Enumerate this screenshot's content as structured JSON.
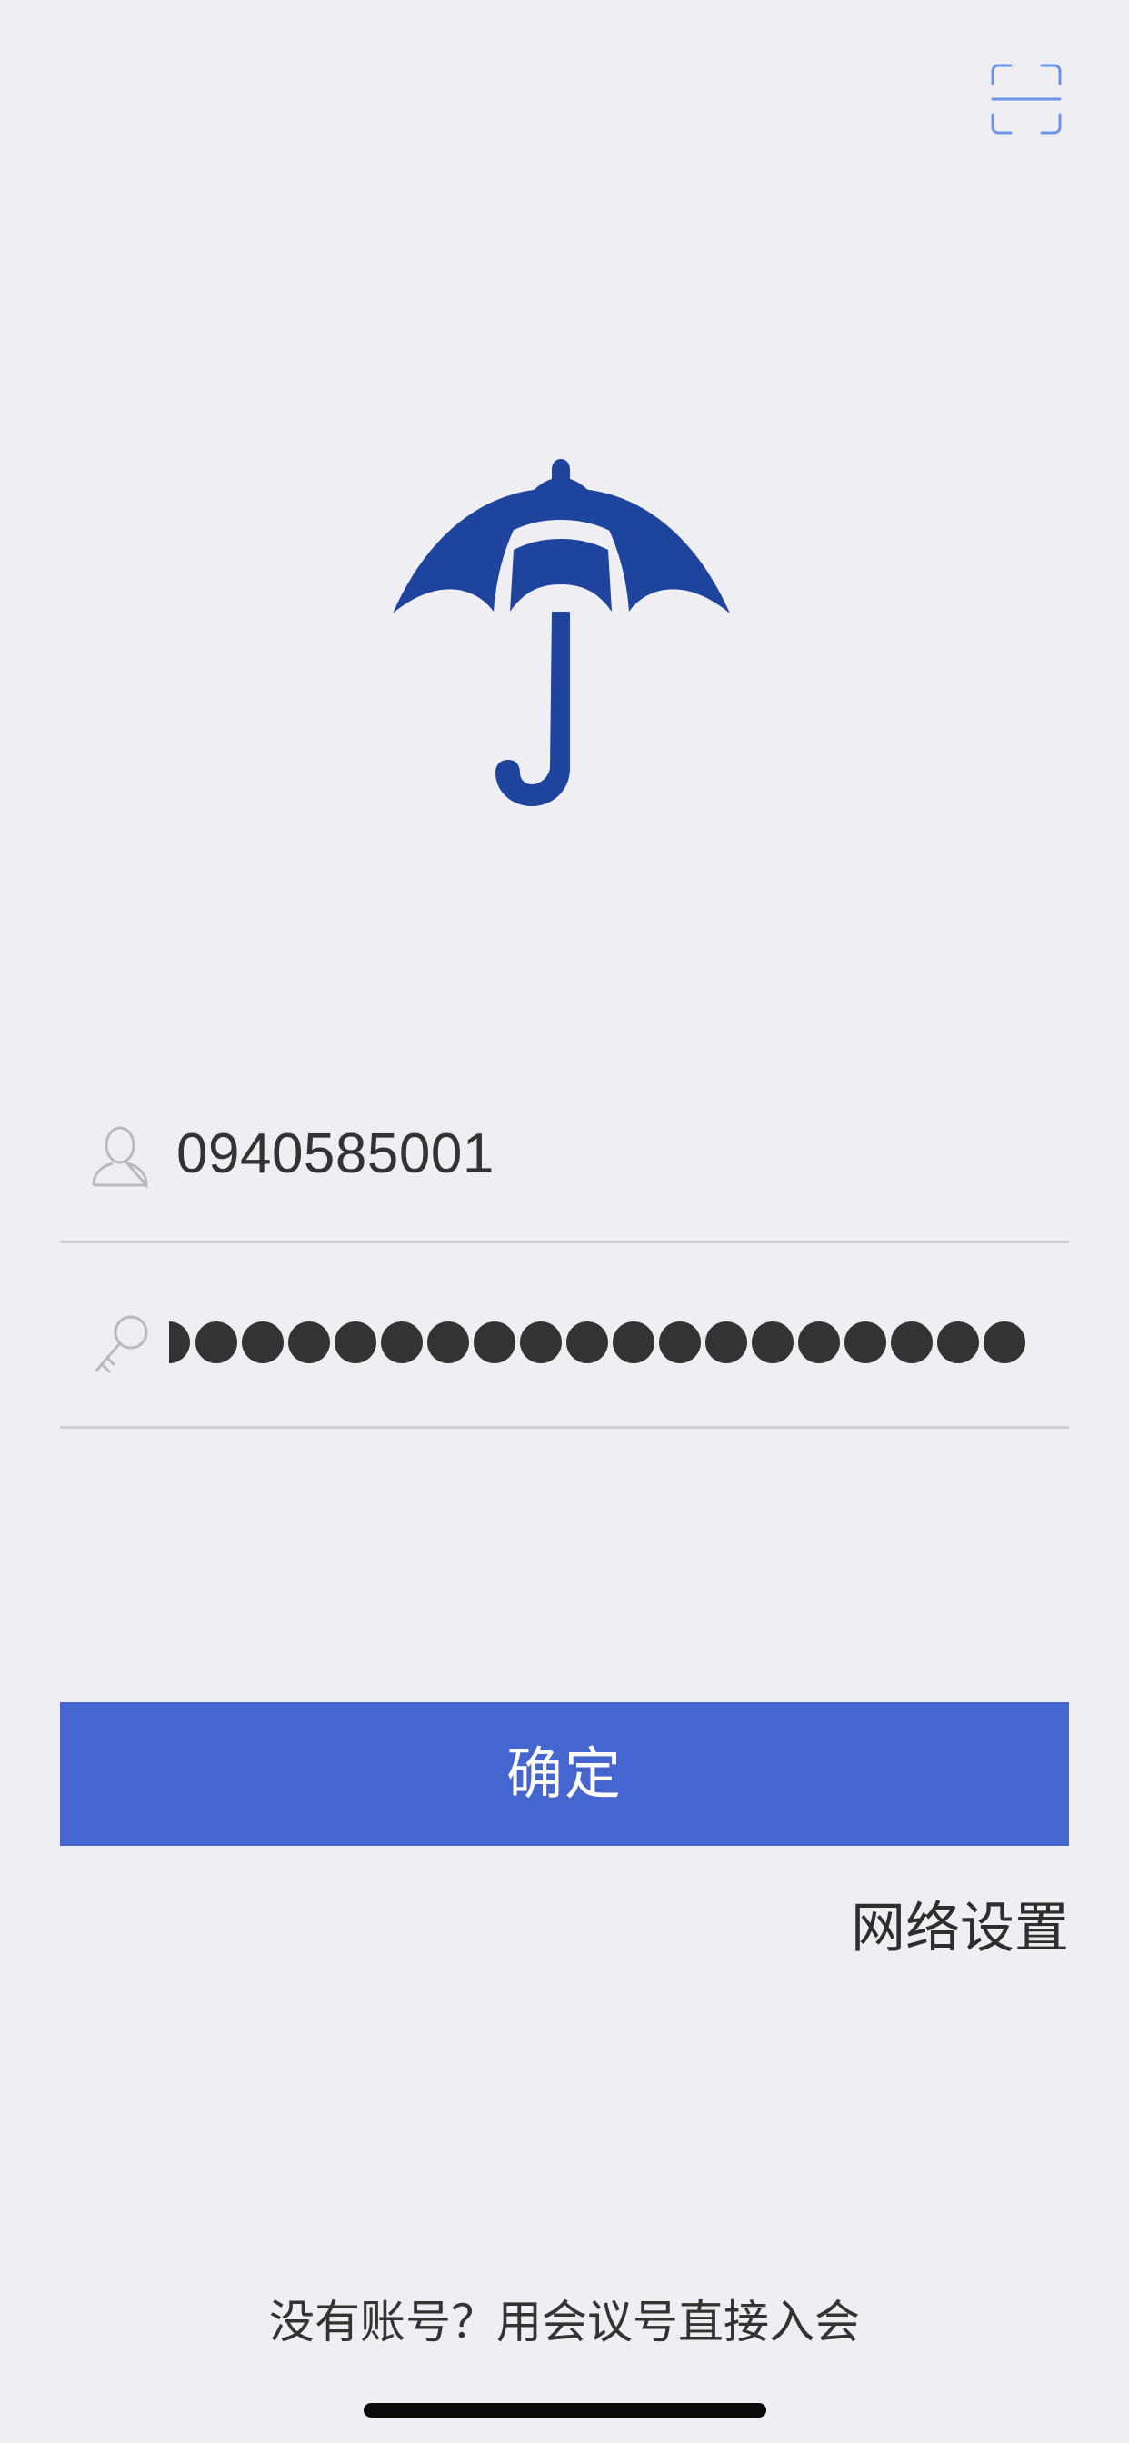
{
  "header": {
    "scan_icon": "scan-frame-icon",
    "scan_color": "#4a78e6"
  },
  "logo": {
    "icon": "umbrella-logo-icon",
    "color": "#1e449e"
  },
  "login": {
    "account_icon": "user-icon",
    "account_value": "0940585001",
    "password_icon": "key-icon",
    "password_mask_count": 19
  },
  "actions": {
    "confirm_label": "确定",
    "confirm_color": "#4565cf",
    "network_settings_label": "网络设置",
    "join_label": "没有账号？用会议号直接入会"
  }
}
